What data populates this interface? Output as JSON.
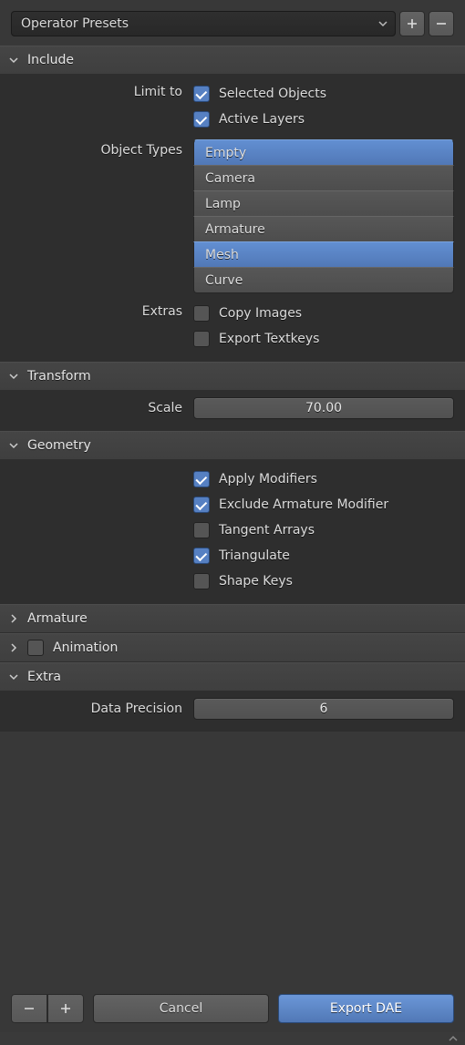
{
  "presets": {
    "label": "Operator Presets"
  },
  "sections": {
    "include": {
      "title": "Include"
    },
    "transform": {
      "title": "Transform"
    },
    "geometry": {
      "title": "Geometry"
    },
    "armature": {
      "title": "Armature"
    },
    "animation": {
      "title": "Animation"
    },
    "extra": {
      "title": "Extra"
    }
  },
  "include": {
    "limit_label": "Limit to",
    "selected_objects": "Selected Objects",
    "active_layers": "Active Layers",
    "object_types_label": "Object Types",
    "types": {
      "empty": "Empty",
      "camera": "Camera",
      "lamp": "Lamp",
      "armature": "Armature",
      "mesh": "Mesh",
      "curve": "Curve"
    },
    "extras_label": "Extras",
    "copy_images": "Copy Images",
    "export_textkeys": "Export Textkeys"
  },
  "transform": {
    "scale_label": "Scale",
    "scale_value": "70.00"
  },
  "geometry": {
    "apply_modifiers": "Apply Modifiers",
    "exclude_armature": "Exclude Armature Modifier",
    "tangent_arrays": "Tangent Arrays",
    "triangulate": "Triangulate",
    "shape_keys": "Shape Keys"
  },
  "extra": {
    "precision_label": "Data Precision",
    "precision_value": "6"
  },
  "footer": {
    "cancel": "Cancel",
    "export": "Export DAE"
  }
}
